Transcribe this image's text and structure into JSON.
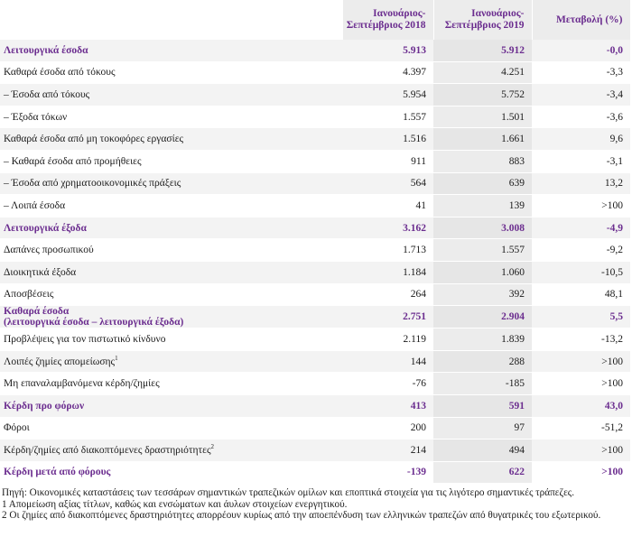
{
  "header": {
    "col_2018": "Ιανουάριος-\nΣεπτέμβριος 2018",
    "col_2018_l1": "Ιανουάριος-",
    "col_2018_l2": "Σεπτέμβριος 2018",
    "col_2019_l1": "Ιανουάριος-",
    "col_2019_l2": "Σεπτέμβριος 2019",
    "col_change": "Μεταβολή (%)"
  },
  "rows": [
    {
      "label": "Λειτουργικά έσοδα",
      "v2018": "5.913",
      "v2019": "5.912",
      "change": "-0,0",
      "bold": true
    },
    {
      "label": "Καθαρά έσοδα από τόκους",
      "v2018": "4.397",
      "v2019": "4.251",
      "change": "-3,3"
    },
    {
      "label": "–  Έσοδα από τόκους",
      "v2018": "5.954",
      "v2019": "5.752",
      "change": "-3,4"
    },
    {
      "label": "–  Έξοδα τόκων",
      "v2018": "1.557",
      "v2019": "1.501",
      "change": "-3,6"
    },
    {
      "label": "Καθαρά έσοδα από μη τοκοφόρες εργασίες",
      "v2018": "1.516",
      "v2019": "1.661",
      "change": "9,6"
    },
    {
      "label": "–  Καθαρά έσοδα από προμήθειες",
      "v2018": "911",
      "v2019": "883",
      "change": "-3,1"
    },
    {
      "label": "–  Έσοδα από χρηματοοικονομικές πράξεις",
      "v2018": "564",
      "v2019": "639",
      "change": "13,2"
    },
    {
      "label": "–  Λοιπά έσοδα",
      "v2018": "41",
      "v2019": "139",
      "change": ">100"
    },
    {
      "label": "Λειτουργικά έξοδα",
      "v2018": "3.162",
      "v2019": "3.008",
      "change": "-4,9",
      "bold": true
    },
    {
      "label": "Δαπάνες προσωπικού",
      "v2018": "1.713",
      "v2019": "1.557",
      "change": "-9,2"
    },
    {
      "label": "Διοικητικά έξοδα",
      "v2018": "1.184",
      "v2019": "1.060",
      "change": "-10,5"
    },
    {
      "label": "Αποσβέσεις",
      "v2018": "264",
      "v2019": "392",
      "change": "48,1"
    },
    {
      "label_l1": "Καθαρά έσοδα",
      "label_l2": "(λειτουργικά έσοδα – λειτουργικά έξοδα)",
      "v2018": "2.751",
      "v2019": "2.904",
      "change": "5,5",
      "bold": true
    },
    {
      "label": "Προβλέψεις για τον πιστωτικό κίνδυνο",
      "v2018": "2.119",
      "v2019": "1.839",
      "change": "-13,2"
    },
    {
      "label": "Λοιπές ζημίες απομείωσης",
      "sup": "1",
      "v2018": "144",
      "v2019": "288",
      "change": ">100"
    },
    {
      "label": "Μη επαναλαμβανόμενα κέρδη/ζημίες",
      "v2018": "-76",
      "v2019": "-185",
      "change": ">100"
    },
    {
      "label": "Κέρδη προ φόρων",
      "v2018": "413",
      "v2019": "591",
      "change": "43,0",
      "bold": true
    },
    {
      "label": "Φόροι",
      "v2018": "200",
      "v2019": "97",
      "change": "-51,2"
    },
    {
      "label": "Κέρδη/ζημίες από διακοπτόμενες δραστηριότητες",
      "sup": "2",
      "v2018": "214",
      "v2019": "494",
      "change": ">100"
    },
    {
      "label": "Κέρδη μετά από φόρους",
      "v2018": "-139",
      "v2019": "622",
      "change": ">100",
      "bold": true
    }
  ],
  "footnotes": {
    "source": "Πηγή: Οικονομικές καταστάσεις των τεσσάρων σημαντικών τραπεζικών ομίλων και εποπτικά στοιχεία για τις λιγότερο σημαντικές τράπεζες.",
    "note1": "1 Απομείωση αξίας τίτλων, καθώς και ενσώματων και άυλων στοιχείων ενεργητικού.",
    "note2": "2 Οι ζημίες από διακοπτόμενες δραστηριότητες απορρέουν κυρίως από την αποεπένδυση των ελληνικών τραπεζών από θυγατρικές του εξωτερικού."
  },
  "colors": {
    "accent": "#6b2d8f",
    "header_bg": "#ececec",
    "row_alt_bg": "#f3f3f3"
  }
}
